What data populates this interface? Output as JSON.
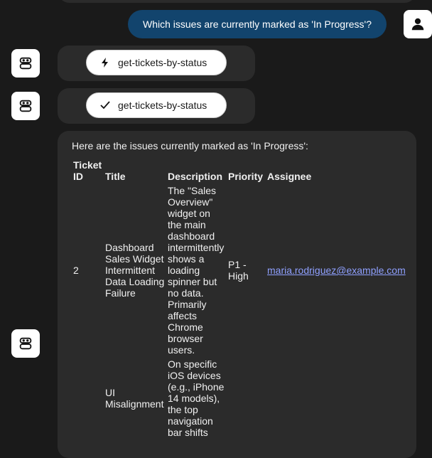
{
  "user_message": "Which issues are currently marked as 'In Progress'?",
  "tool_calls": [
    {
      "label": "get-tickets-by-status",
      "icon": "lightning-icon"
    },
    {
      "label": "get-tickets-by-status",
      "icon": "check-icon"
    }
  ],
  "answer": {
    "intro": "Here are the issues currently marked as 'In Progress':",
    "headers": {
      "id": "Ticket ID",
      "title": "Title",
      "description": "Description",
      "priority": "Priority",
      "assignee": "Assignee"
    },
    "rows": [
      {
        "id": "2",
        "title": "Dashboard Sales Widget Intermittent Data Loading Failure",
        "description": "The \"Sales Overview\" widget on the main dashboard intermittently shows a loading spinner but no data. Primarily affects Chrome browser users.",
        "priority": "P1 - High",
        "assignee": "maria.rodriguez@example.com"
      },
      {
        "id": "",
        "title": "UI Misalignment",
        "description": "On specific iOS devices (e.g., iPhone 14 models), the top navigation bar shifts",
        "priority": "",
        "assignee": ""
      }
    ]
  },
  "colors": {
    "background": "#1a1a1a",
    "bubble": "#2b2b2b",
    "user_bubble": "#12446d",
    "link": "#8fa0ff"
  }
}
